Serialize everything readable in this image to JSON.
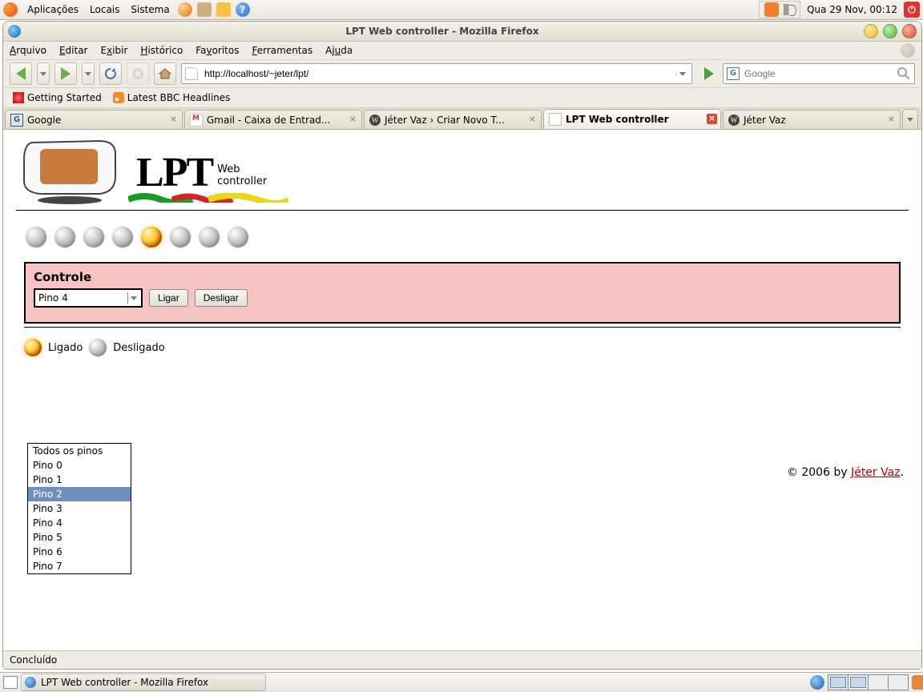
{
  "gnome": {
    "menus": [
      "Aplicações",
      "Locais",
      "Sistema"
    ],
    "clock": "Qua 29 Nov, 00:12"
  },
  "window": {
    "title": "LPT Web controller - Mozilla Firefox"
  },
  "menubar": [
    {
      "letter": "A",
      "rest": "rquivo"
    },
    {
      "letter": "E",
      "rest": "ditar"
    },
    {
      "letter": "x",
      "pre": "E",
      "rest": "ibir"
    },
    {
      "letter": "H",
      "rest": "istórico"
    },
    {
      "letter": "v",
      "pre": "Fa",
      "rest": "oritos"
    },
    {
      "letter": "F",
      "rest": "erramentas"
    },
    {
      "letter": "u",
      "pre": "Aj",
      "rest": "da"
    }
  ],
  "url": "http://localhost/~jeter/lpt/",
  "search_ph": "Google",
  "bookmarks": {
    "b1": "Getting Started",
    "b2": "Latest BBC Headlines"
  },
  "tabs": [
    {
      "label": "Google",
      "type": "g"
    },
    {
      "label": "Gmail - Caixa de Entrad...",
      "type": "gm"
    },
    {
      "label": "Jéter Vaz › Criar Novo T...",
      "type": "wp"
    },
    {
      "label": "LPT Web controller",
      "type": "page",
      "active": true
    },
    {
      "label": "Jéter Vaz",
      "type": "wp"
    }
  ],
  "page": {
    "logo_text": "LPT",
    "logo_sub1": "Web",
    "logo_sub2": "controller",
    "panel_title": "Controle",
    "select_value": "Pino 4",
    "btn_on": "Ligar",
    "btn_off": "Desligar",
    "legend_on": "Ligado",
    "legend_off": "Desligado",
    "copyright_pre": "© 2006 by ",
    "copyright_link": "Jéter Vaz",
    "copyright_post": "."
  },
  "dropdown": {
    "options": [
      "Todos os pinos",
      "Pino 0",
      "Pino 1",
      "Pino 2",
      "Pino 3",
      "Pino 4",
      "Pino 5",
      "Pino 6",
      "Pino 7"
    ],
    "highlighted": "Pino 2"
  },
  "leds": [
    false,
    false,
    false,
    false,
    true,
    false,
    false,
    false
  ],
  "statusbar": "Concluído",
  "taskbar": "LPT Web controller - Mozilla Firefox"
}
